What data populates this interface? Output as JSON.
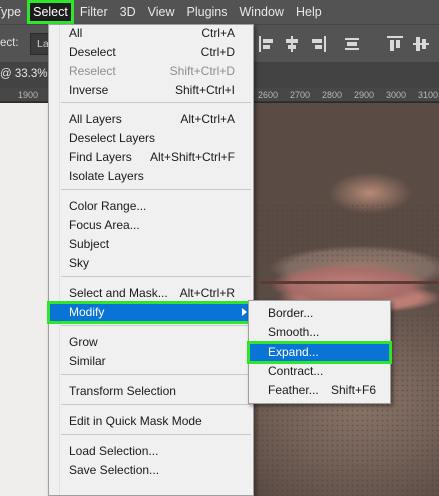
{
  "menubar": {
    "items": [
      "Type",
      "Select",
      "Filter",
      "3D",
      "View",
      "Plugins",
      "Window",
      "Help"
    ],
    "active": "Select"
  },
  "options": {
    "label": "ect:",
    "select_value": "La"
  },
  "doc_tab": {
    "text": "@ 33.3% ("
  },
  "ruler": {
    "ticks": [
      "1900",
      "2600",
      "2700",
      "2800",
      "2900",
      "3000",
      "3100"
    ]
  },
  "select_menu": {
    "groups": [
      [
        {
          "label": "All",
          "shortcut": "Ctrl+A"
        },
        {
          "label": "Deselect",
          "shortcut": "Ctrl+D"
        },
        {
          "label": "Reselect",
          "shortcut": "Shift+Ctrl+D",
          "disabled": true
        },
        {
          "label": "Inverse",
          "shortcut": "Shift+Ctrl+I"
        }
      ],
      [
        {
          "label": "All Layers",
          "shortcut": "Alt+Ctrl+A"
        },
        {
          "label": "Deselect Layers",
          "shortcut": ""
        },
        {
          "label": "Find Layers",
          "shortcut": "Alt+Shift+Ctrl+F"
        },
        {
          "label": "Isolate Layers",
          "shortcut": ""
        }
      ],
      [
        {
          "label": "Color Range...",
          "shortcut": ""
        },
        {
          "label": "Focus Area...",
          "shortcut": ""
        },
        {
          "label": "Subject",
          "shortcut": ""
        },
        {
          "label": "Sky",
          "shortcut": ""
        }
      ],
      [
        {
          "label": "Select and Mask...",
          "shortcut": "Alt+Ctrl+R"
        },
        {
          "label": "Modify",
          "shortcut": "",
          "submenu": true,
          "highlighted": true
        }
      ],
      [
        {
          "label": "Grow",
          "shortcut": ""
        },
        {
          "label": "Similar",
          "shortcut": ""
        }
      ],
      [
        {
          "label": "Transform Selection",
          "shortcut": ""
        }
      ],
      [
        {
          "label": "Edit in Quick Mask Mode",
          "shortcut": ""
        }
      ],
      [
        {
          "label": "Load Selection...",
          "shortcut": ""
        },
        {
          "label": "Save Selection...",
          "shortcut": ""
        }
      ]
    ]
  },
  "modify_submenu": {
    "items": [
      {
        "label": "Border...",
        "shortcut": ""
      },
      {
        "label": "Smooth...",
        "shortcut": ""
      },
      {
        "label": "Expand...",
        "shortcut": "",
        "highlighted": true
      },
      {
        "label": "Contract...",
        "shortcut": ""
      },
      {
        "label": "Feather...",
        "shortcut": "Shift+F6"
      }
    ]
  },
  "colors": {
    "highlight": "#0a74d6",
    "annotation": "#2ee62e",
    "menubar_bg": "#535353",
    "menu_bg": "#f0f0f0"
  }
}
